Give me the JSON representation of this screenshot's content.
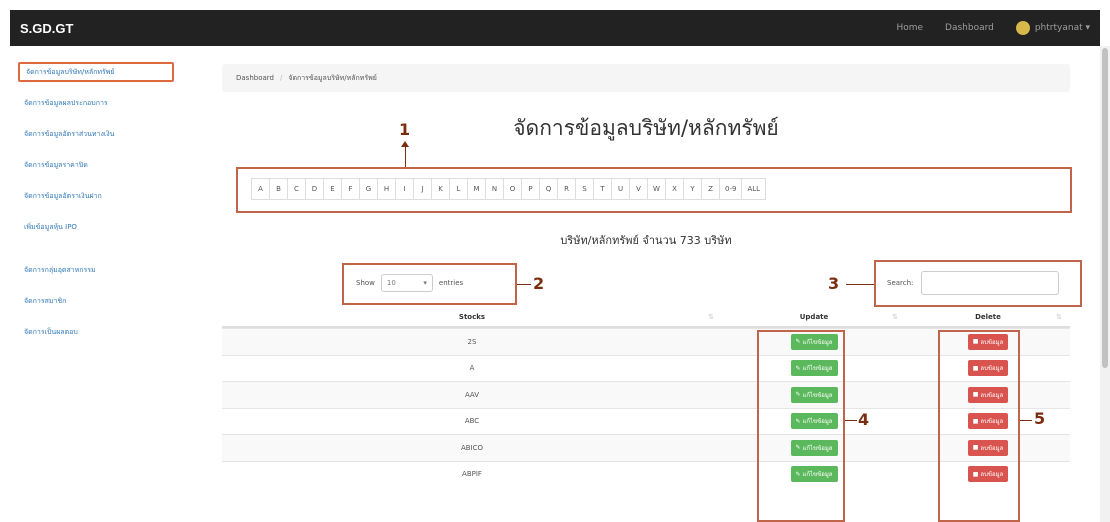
{
  "navbar": {
    "brand": "S.GD.GT",
    "home": "Home",
    "dashboard": "Dashboard",
    "user": "phtrtyanat ▾"
  },
  "sidebar": {
    "items": [
      {
        "label": "จัดการข้อมูลบริษัท/หลักทรัพย์",
        "active": true
      },
      {
        "label": "จัดการข้อมูลผลประกอบการ"
      },
      {
        "label": "จัดการข้อมูลอัตราส่วนทางเงิน"
      },
      {
        "label": "จัดการข้อมูลราคาปิด"
      },
      {
        "label": "จัดการข้อมูลอัตราเงินฝาก"
      },
      {
        "label": "เพิ่มข้อมูลหุ้น IPO"
      },
      {
        "label": "จัดการกลุ่มอุตสาหกรรม"
      },
      {
        "label": "จัดการสมาชิก"
      },
      {
        "label": "จัดการเป็นผลตอบ"
      }
    ]
  },
  "breadcrumb": {
    "root": "Dashboard",
    "separator": "/",
    "current": "จัดการข้อมูลบริษัท/หลักทรัพย์"
  },
  "page_title": "จัดการข้อมูลบริษัท/หลักทรัพย์",
  "alphabet": [
    "A",
    "B",
    "C",
    "D",
    "E",
    "F",
    "G",
    "H",
    "I",
    "J",
    "K",
    "L",
    "M",
    "N",
    "O",
    "P",
    "Q",
    "R",
    "S",
    "T",
    "U",
    "V",
    "W",
    "X",
    "Y",
    "Z",
    "0-9",
    "ALL"
  ],
  "count_text": "บริษัท/หลักทรัพย์ จำนวน 733 บริษัท",
  "length_control": {
    "show": "Show",
    "value": "10",
    "entries": "entries"
  },
  "search": {
    "label": "Search:",
    "value": ""
  },
  "table": {
    "headers": {
      "stocks": "Stocks",
      "update": "Update",
      "delete": "Delete"
    },
    "update_label": "แก้ไขข้อมูล",
    "delete_label": "ลบข้อมูล",
    "rows": [
      "2S",
      "A",
      "AAV",
      "ABC",
      "ABICO",
      "ABPIF"
    ]
  },
  "callouts": [
    "1",
    "2",
    "3",
    "4",
    "5"
  ],
  "colors": {
    "navbar": "#222222",
    "callout_border": "#c0644a",
    "callout_text": "#7a2d10",
    "update_btn": "#5cb85c",
    "delete_btn": "#d9534f",
    "link": "#337ab7"
  }
}
